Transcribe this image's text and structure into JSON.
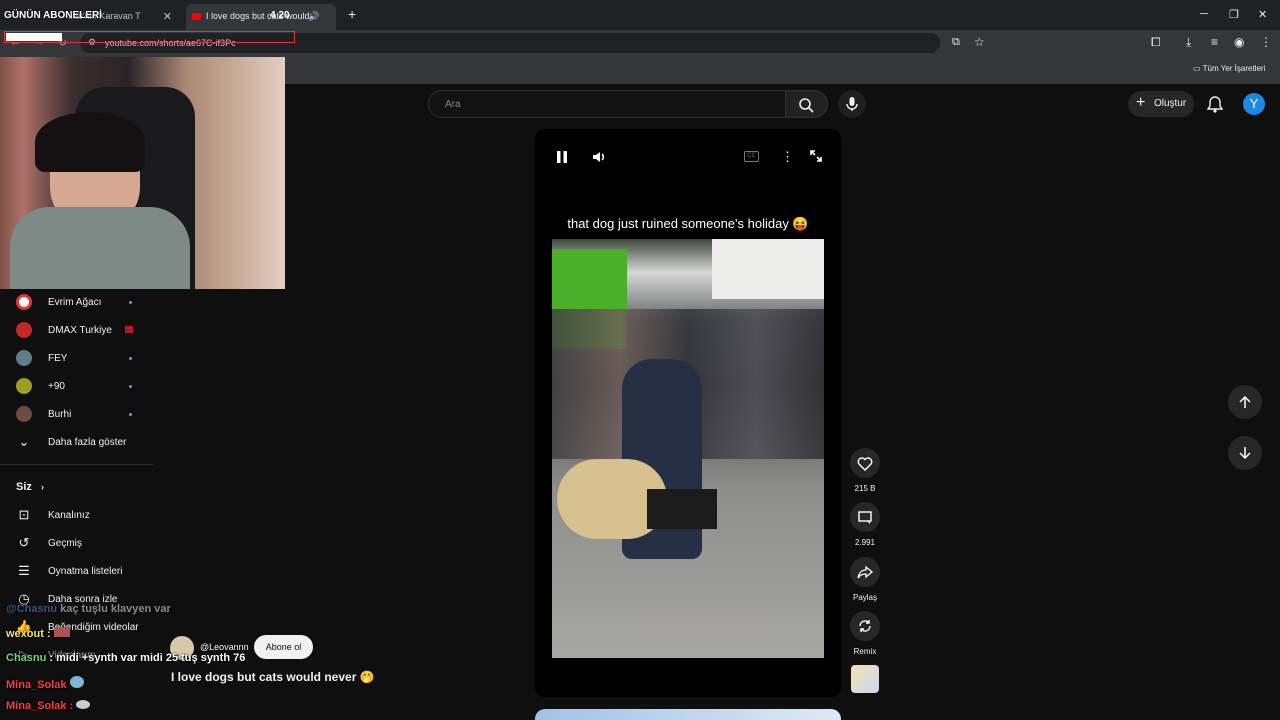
{
  "browser": {
    "tabs": [
      {
        "label": "...te'nin Karavan T"
      },
      {
        "label": "I love dogs but cats would"
      }
    ],
    "url": "youtube.com/shorts/ae67C-if3Pc",
    "bookmarks_label": "Tüm Yer İşaretleri"
  },
  "stream_overlay": {
    "subscribers_title": "GÜNÜN ABONELERİ",
    "counter": "4 20"
  },
  "header": {
    "search_placeholder": "Ara",
    "create_label": "Oluştur",
    "avatar_letter": "Y"
  },
  "sidebar": {
    "subscriptions": [
      {
        "label": "Evrim Ağacı",
        "color": "#e53935"
      },
      {
        "label": "DMAX Turkiye",
        "color": "#c62828"
      },
      {
        "label": "FEY",
        "color": "#607d8b"
      },
      {
        "label": "+90",
        "color": "#9e9d24"
      },
      {
        "label": "Burhi",
        "color": "#6d4c41"
      }
    ],
    "show_more": "Daha fazla göster",
    "you_heading": "Siz",
    "you_items": [
      {
        "label": "Kanalınız",
        "icon": "user-square-icon"
      },
      {
        "label": "Geçmiş",
        "icon": "history-icon"
      },
      {
        "label": "Oynatma listeleri",
        "icon": "playlist-icon"
      },
      {
        "label": "Daha sonra izle",
        "icon": "clock-icon"
      },
      {
        "label": "Beğendiğim videolar",
        "icon": "thumbs-up-icon"
      },
      {
        "label": "Videolarım",
        "icon": "video-icon"
      }
    ]
  },
  "short": {
    "caption": "that dog just ruined someone's holiday 😝",
    "channel": "@Leovannn",
    "subscribe": "Abone ol",
    "title": "I love dogs but cats would never 🤭",
    "likes": "215 B",
    "comments": "2.991",
    "share": "Paylaş",
    "remix": "Remix"
  },
  "chat": [
    {
      "user": "wexout :",
      "text": "",
      "color": "#f5e663"
    },
    {
      "user": "Chasnu",
      "text": ": midi +synth var midi 25 tuş synth 76",
      "color": "#7bd36f"
    },
    {
      "user": "Mina_Solak",
      "text": "",
      "color": "#ff3b3b"
    },
    {
      "user": "Mina_Solak :",
      "text": "",
      "color": "#ff3b3b"
    },
    {
      "user": "@Chasnu",
      "text": "kaç tuşlu klavyen var",
      "color": "#5a7fd1"
    }
  ]
}
